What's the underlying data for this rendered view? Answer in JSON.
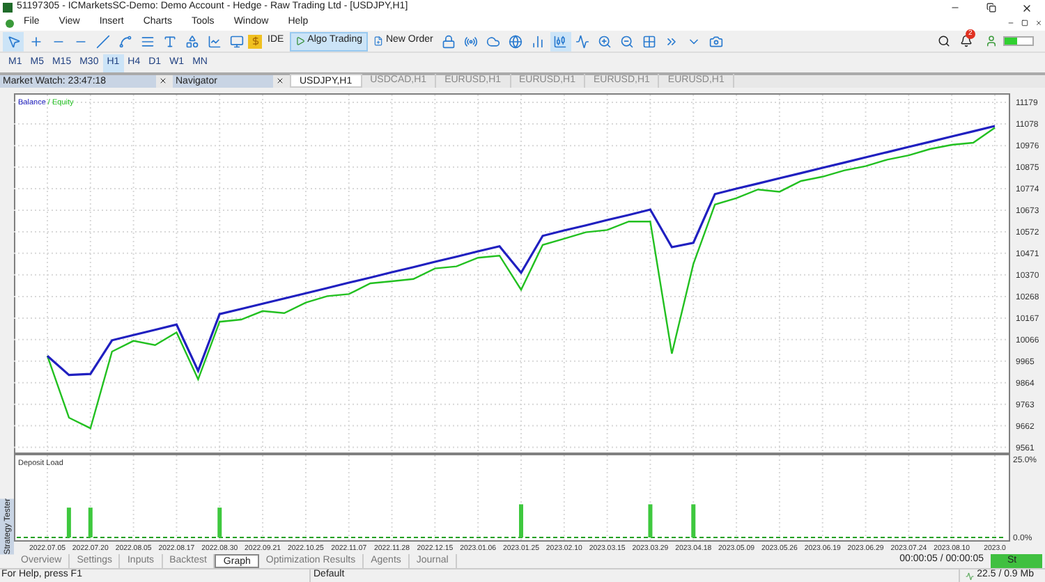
{
  "window": {
    "title": "51197305 - ICMarketsSC-Demo: Demo Account - Hedge - Raw Trading Ltd - [USDJPY,H1]"
  },
  "menu": [
    "File",
    "View",
    "Insert",
    "Charts",
    "Tools",
    "Window",
    "Help"
  ],
  "toolbar": {
    "buttons": [
      {
        "label": "IDE",
        "active": false
      },
      {
        "label": "Algo Trading",
        "active": true
      },
      {
        "label": "New Order",
        "active": false
      }
    ],
    "notifications": "2"
  },
  "timeframes": [
    {
      "label": "M1",
      "selected": false
    },
    {
      "label": "M5",
      "selected": false
    },
    {
      "label": "M15",
      "selected": false
    },
    {
      "label": "M30",
      "selected": false
    },
    {
      "label": "H1",
      "selected": true
    },
    {
      "label": "H4",
      "selected": false
    },
    {
      "label": "D1",
      "selected": false
    },
    {
      "label": "W1",
      "selected": false
    },
    {
      "label": "MN",
      "selected": false
    }
  ],
  "panels": [
    "Market Watch: 23:47:18",
    "Navigator"
  ],
  "chart_tabs": [
    {
      "label": "USDJPY,H1",
      "selected": true
    },
    {
      "label": "USDCAD,H1",
      "selected": false
    },
    {
      "label": "EURUSD,H1",
      "selected": false
    },
    {
      "label": "EURUSD,H1",
      "selected": false
    },
    {
      "label": "EURUSD,H1",
      "selected": false
    },
    {
      "label": "EURUSD,H1",
      "selected": false
    }
  ],
  "tester_label": "Strategy Tester",
  "balance_chart": {
    "legend_separator": "/",
    "chart_data": {
      "type": "line",
      "grid": true,
      "ylim": [
        9530,
        11215
      ],
      "yticks": [
        11179,
        11078,
        10976,
        10875,
        10774,
        10673,
        10572,
        10471,
        10370,
        10268,
        10167,
        10066,
        9965,
        9864,
        9763,
        9662,
        9561
      ],
      "categories": [
        null,
        null,
        null,
        null,
        null,
        null,
        null,
        null,
        null,
        null,
        null,
        null,
        null,
        null,
        null,
        null,
        null,
        null,
        null,
        null,
        null,
        null,
        null,
        null,
        null,
        null,
        null,
        null,
        null,
        null,
        null,
        null,
        null,
        null,
        null,
        null,
        null,
        null,
        null,
        null,
        null,
        null,
        null,
        null,
        null
      ],
      "series": [
        {
          "name": "Balance",
          "color": "#2020c0",
          "values": [
            9990,
            9900,
            9905,
            10063,
            10088,
            10112,
            10137,
            9920,
            10186,
            10210,
            10235,
            10259,
            10284,
            10308,
            10333,
            10357,
            10382,
            10406,
            10431,
            10455,
            10480,
            10504,
            10380,
            10553,
            10578,
            10602,
            10627,
            10651,
            10676,
            10500,
            10520,
            10749,
            10774,
            10798,
            10823,
            10847,
            10872,
            10896,
            10921,
            10945,
            10970,
            10994,
            11019,
            11043,
            11068
          ]
        },
        {
          "name": "Equity",
          "color": "#22c020",
          "values": [
            9990,
            9700,
            9650,
            10010,
            10060,
            10040,
            10100,
            9880,
            10150,
            10160,
            10200,
            10190,
            10240,
            10270,
            10280,
            10330,
            10340,
            10350,
            10400,
            10410,
            10450,
            10460,
            10300,
            10510,
            10540,
            10570,
            10580,
            10620,
            10620,
            10000,
            10420,
            10700,
            10730,
            10770,
            10760,
            10810,
            10830,
            10860,
            10880,
            10910,
            10930,
            10960,
            10980,
            10990,
            11060
          ]
        }
      ]
    }
  },
  "deposit_chart": {
    "chart_data": {
      "type": "bar",
      "grid": true,
      "title": "Deposit Load",
      "ylim": [
        0,
        25
      ],
      "yticks": [
        {
          "value": 25,
          "label": "25.0%"
        },
        {
          "value": 0,
          "label": "0.0%"
        }
      ],
      "categories": [
        "2022.07.05",
        null,
        "2022.07.20",
        null,
        "2022.08.05",
        null,
        "2022.08.17",
        null,
        "2022.08.30",
        null,
        "2022.09.21",
        null,
        "2022.10.25",
        null,
        "2022.11.07",
        null,
        "2022.11.28",
        null,
        "2022.12.15",
        null,
        "2023.01.06",
        null,
        "2023.01.25",
        null,
        "2023.02.10",
        null,
        "2023.03.15",
        null,
        "2023.03.29",
        null,
        "2023.04.18",
        null,
        "2023.05.09",
        null,
        "2023.05.26",
        null,
        "2023.06.19",
        null,
        "2023.06.29",
        null,
        "2023.07.24",
        null,
        "2023.08.10",
        null,
        "2023.0"
      ],
      "values": [
        0,
        9,
        9,
        0,
        0,
        0,
        0,
        0,
        9,
        0,
        0,
        0,
        0,
        0,
        0,
        0,
        0,
        0,
        0,
        0,
        0,
        0,
        10,
        0,
        0,
        0,
        0,
        0,
        10,
        0,
        10,
        0,
        0,
        0,
        0,
        0,
        0,
        0,
        0,
        0,
        0,
        0,
        0,
        0,
        0
      ]
    }
  },
  "tester_tabs": [
    {
      "label": "Overview",
      "selected": false
    },
    {
      "label": "Settings",
      "selected": false
    },
    {
      "label": "Inputs",
      "selected": false
    },
    {
      "label": "Backtest",
      "selected": false
    },
    {
      "label": "Graph",
      "selected": true
    },
    {
      "label": "Optimization Results",
      "selected": false
    },
    {
      "label": "Agents",
      "selected": false
    },
    {
      "label": "Journal",
      "selected": false
    }
  ],
  "elapsed": "00:00:05 / 00:00:05",
  "start_button": "St",
  "status_bar": {
    "help": "For Help, press F1",
    "profile": "Default",
    "traffic": "22.5 / 0.9 Mb"
  }
}
